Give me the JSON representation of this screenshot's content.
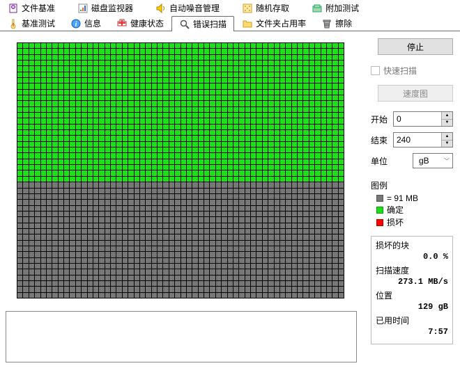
{
  "tabs_row1": [
    {
      "label": "文件基准",
      "icon": "file-benchmark"
    },
    {
      "label": "磁盘监视器",
      "icon": "disk-monitor"
    },
    {
      "label": "自动噪音管理",
      "icon": "speaker"
    },
    {
      "label": "随机存取",
      "icon": "random"
    },
    {
      "label": "附加测试",
      "icon": "extra"
    }
  ],
  "tabs_row2": [
    {
      "label": "基准测试",
      "icon": "thermometer"
    },
    {
      "label": "信息",
      "icon": "info"
    },
    {
      "label": "健康状态",
      "icon": "health"
    },
    {
      "label": "错误扫描",
      "icon": "search",
      "active": true
    },
    {
      "label": "文件夹占用率",
      "icon": "folder"
    },
    {
      "label": "擦除",
      "icon": "trash"
    }
  ],
  "side": {
    "stop_btn": "停止",
    "quick_scan": "快速扫描",
    "speed_map_btn": "速度图",
    "fields": {
      "start_label": "开始",
      "start_value": "0",
      "end_label": "结束",
      "end_value": "240",
      "unit_label": "单位",
      "unit_value": "gB"
    },
    "legend": {
      "title": "图例",
      "block_size": "= 91 MB",
      "ok": "确定",
      "bad": "损坏"
    },
    "stats": {
      "damaged_label": "损坏的块",
      "damaged_value": "0.0 %",
      "speed_label": "扫描速度",
      "speed_value": "273.1 MB/s",
      "position_label": "位置",
      "position_value": "129 gB",
      "elapsed_label": "已用时间",
      "elapsed_value": "7:57"
    }
  },
  "grid": {
    "cols": 56,
    "rows": 44,
    "ok_rows": 24
  }
}
